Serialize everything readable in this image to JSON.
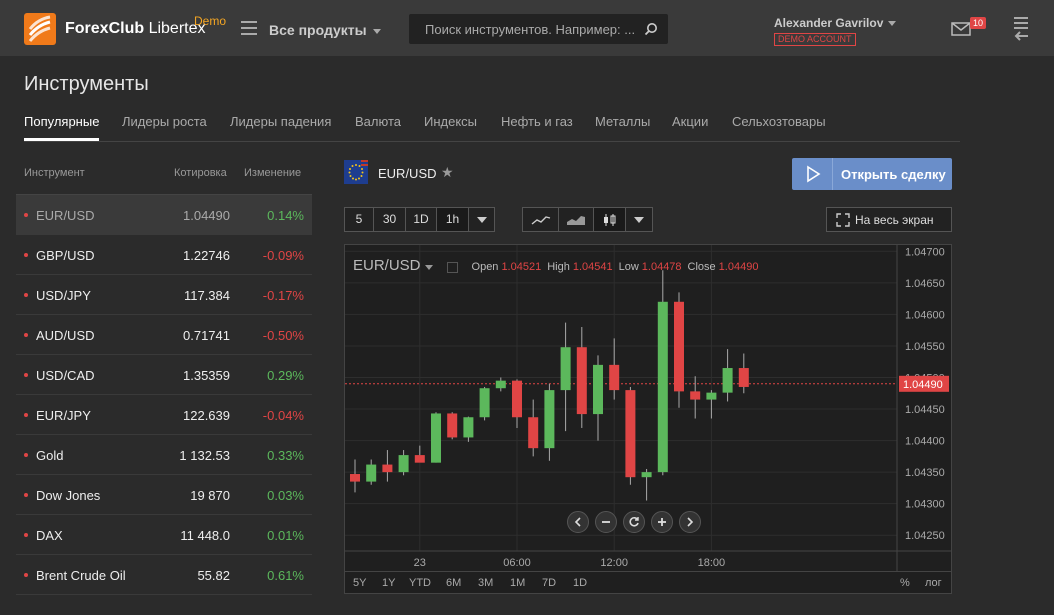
{
  "header": {
    "brand_bold": "ForexClub",
    "brand_rest": " Libertex",
    "demo_label": "Demo",
    "products_label": "Все продукты",
    "search_placeholder": "Поиск инструментов. Например: ...",
    "user_name": "Alexander Gavrilov",
    "account_type": "DEMO ACCOUNT",
    "mail_count": "10"
  },
  "page": {
    "title": "Инструменты",
    "tabs": [
      "Популярные",
      "Лидеры роста",
      "Лидеры падения",
      "Валюта",
      "Индексы",
      "Нефть и газ",
      "Металлы",
      "Акции",
      "Сельхозтовары"
    ]
  },
  "instruments": {
    "col_instrument": "Инструмент",
    "col_quote": "Котировка",
    "col_change": "Изменение",
    "rows": [
      {
        "name": "EUR/USD",
        "price": "1.04490",
        "change": "0.14%",
        "dir": "pos"
      },
      {
        "name": "GBP/USD",
        "price": "1.22746",
        "change": "-0.09%",
        "dir": "neg"
      },
      {
        "name": "USD/JPY",
        "price": "117.384",
        "change": "-0.17%",
        "dir": "neg"
      },
      {
        "name": "AUD/USD",
        "price": "0.71741",
        "change": "-0.50%",
        "dir": "neg"
      },
      {
        "name": "USD/CAD",
        "price": "1.35359",
        "change": "0.29%",
        "dir": "pos"
      },
      {
        "name": "EUR/JPY",
        "price": "122.639",
        "change": "-0.04%",
        "dir": "neg"
      },
      {
        "name": "Gold",
        "price": "1 132.53",
        "change": "0.33%",
        "dir": "pos"
      },
      {
        "name": "Dow Jones",
        "price": "19 870",
        "change": "0.03%",
        "dir": "pos"
      },
      {
        "name": "DAX",
        "price": "11 448.0",
        "change": "0.01%",
        "dir": "pos"
      },
      {
        "name": "Brent Crude Oil",
        "price": "55.82",
        "change": "0.61%",
        "dir": "pos"
      }
    ]
  },
  "chart_panel": {
    "pair": "EUR/USD",
    "open_deal_label": "Открыть сделку",
    "timeframes": [
      "5",
      "30",
      "1D",
      "1h"
    ],
    "fullscreen_label": "На весь экран",
    "ranges": [
      "5Y",
      "1Y",
      "YTD",
      "6M",
      "3M",
      "1M",
      "7D",
      "1D"
    ],
    "percent_label": "%",
    "log_label": "лог"
  },
  "chart_data": {
    "type": "candlestick",
    "symbol": "EUR/USD",
    "ohlc_label": {
      "open_k": "Open",
      "open": "1.04521",
      "high_k": "High",
      "high": "1.04541",
      "low_k": "Low",
      "low": "1.04478",
      "close_k": "Close",
      "close": "1.04490"
    },
    "current_price": "1.04490",
    "ylim": [
      1.04225,
      1.0471
    ],
    "y_ticks": [
      "1.04700",
      "1.04650",
      "1.04600",
      "1.04550",
      "1.04500",
      "1.04450",
      "1.04400",
      "1.04350",
      "1.04300",
      "1.04250"
    ],
    "x_ticks": [
      {
        "label": "23",
        "i": 4
      },
      {
        "label": "06:00",
        "i": 10
      },
      {
        "label": "12:00",
        "i": 16
      },
      {
        "label": "18:00",
        "i": 22
      }
    ],
    "candles": [
      {
        "o": 1.04347,
        "h": 1.0437,
        "l": 1.04318,
        "c": 1.04335
      },
      {
        "o": 1.04335,
        "h": 1.0437,
        "l": 1.0433,
        "c": 1.04362
      },
      {
        "o": 1.04362,
        "h": 1.04385,
        "l": 1.04335,
        "c": 1.0435
      },
      {
        "o": 1.0435,
        "h": 1.04385,
        "l": 1.04345,
        "c": 1.04377
      },
      {
        "o": 1.04377,
        "h": 1.04392,
        "l": 1.04367,
        "c": 1.04365
      },
      {
        "o": 1.04365,
        "h": 1.04445,
        "l": 1.04365,
        "c": 1.04443
      },
      {
        "o": 1.04443,
        "h": 1.04445,
        "l": 1.04402,
        "c": 1.04405
      },
      {
        "o": 1.04405,
        "h": 1.04438,
        "l": 1.04398,
        "c": 1.04437
      },
      {
        "o": 1.04437,
        "h": 1.04485,
        "l": 1.04432,
        "c": 1.04483
      },
      {
        "o": 1.04483,
        "h": 1.045,
        "l": 1.04478,
        "c": 1.04495
      },
      {
        "o": 1.04495,
        "h": 1.04497,
        "l": 1.0442,
        "c": 1.04437
      },
      {
        "o": 1.04437,
        "h": 1.04465,
        "l": 1.04375,
        "c": 1.04388
      },
      {
        "o": 1.04388,
        "h": 1.0449,
        "l": 1.04368,
        "c": 1.0448
      },
      {
        "o": 1.0448,
        "h": 1.04587,
        "l": 1.04415,
        "c": 1.04548
      },
      {
        "o": 1.04548,
        "h": 1.0458,
        "l": 1.0442,
        "c": 1.04442
      },
      {
        "o": 1.04442,
        "h": 1.04535,
        "l": 1.044,
        "c": 1.0452
      },
      {
        "o": 1.0452,
        "h": 1.04562,
        "l": 1.04465,
        "c": 1.0448
      },
      {
        "o": 1.0448,
        "h": 1.04485,
        "l": 1.0433,
        "c": 1.04342
      },
      {
        "o": 1.04342,
        "h": 1.04355,
        "l": 1.04305,
        "c": 1.0435
      },
      {
        "o": 1.0435,
        "h": 1.0467,
        "l": 1.04345,
        "c": 1.0462
      },
      {
        "o": 1.0462,
        "h": 1.04635,
        "l": 1.04452,
        "c": 1.04478
      },
      {
        "o": 1.04478,
        "h": 1.04502,
        "l": 1.04435,
        "c": 1.04465
      },
      {
        "o": 1.04465,
        "h": 1.0448,
        "l": 1.04435,
        "c": 1.04476
      },
      {
        "o": 1.04476,
        "h": 1.04545,
        "l": 1.04462,
        "c": 1.04515
      },
      {
        "o": 1.04515,
        "h": 1.04538,
        "l": 1.04475,
        "c": 1.04485
      }
    ],
    "up_color": "#5cb85c",
    "down_color": "#e04545"
  }
}
